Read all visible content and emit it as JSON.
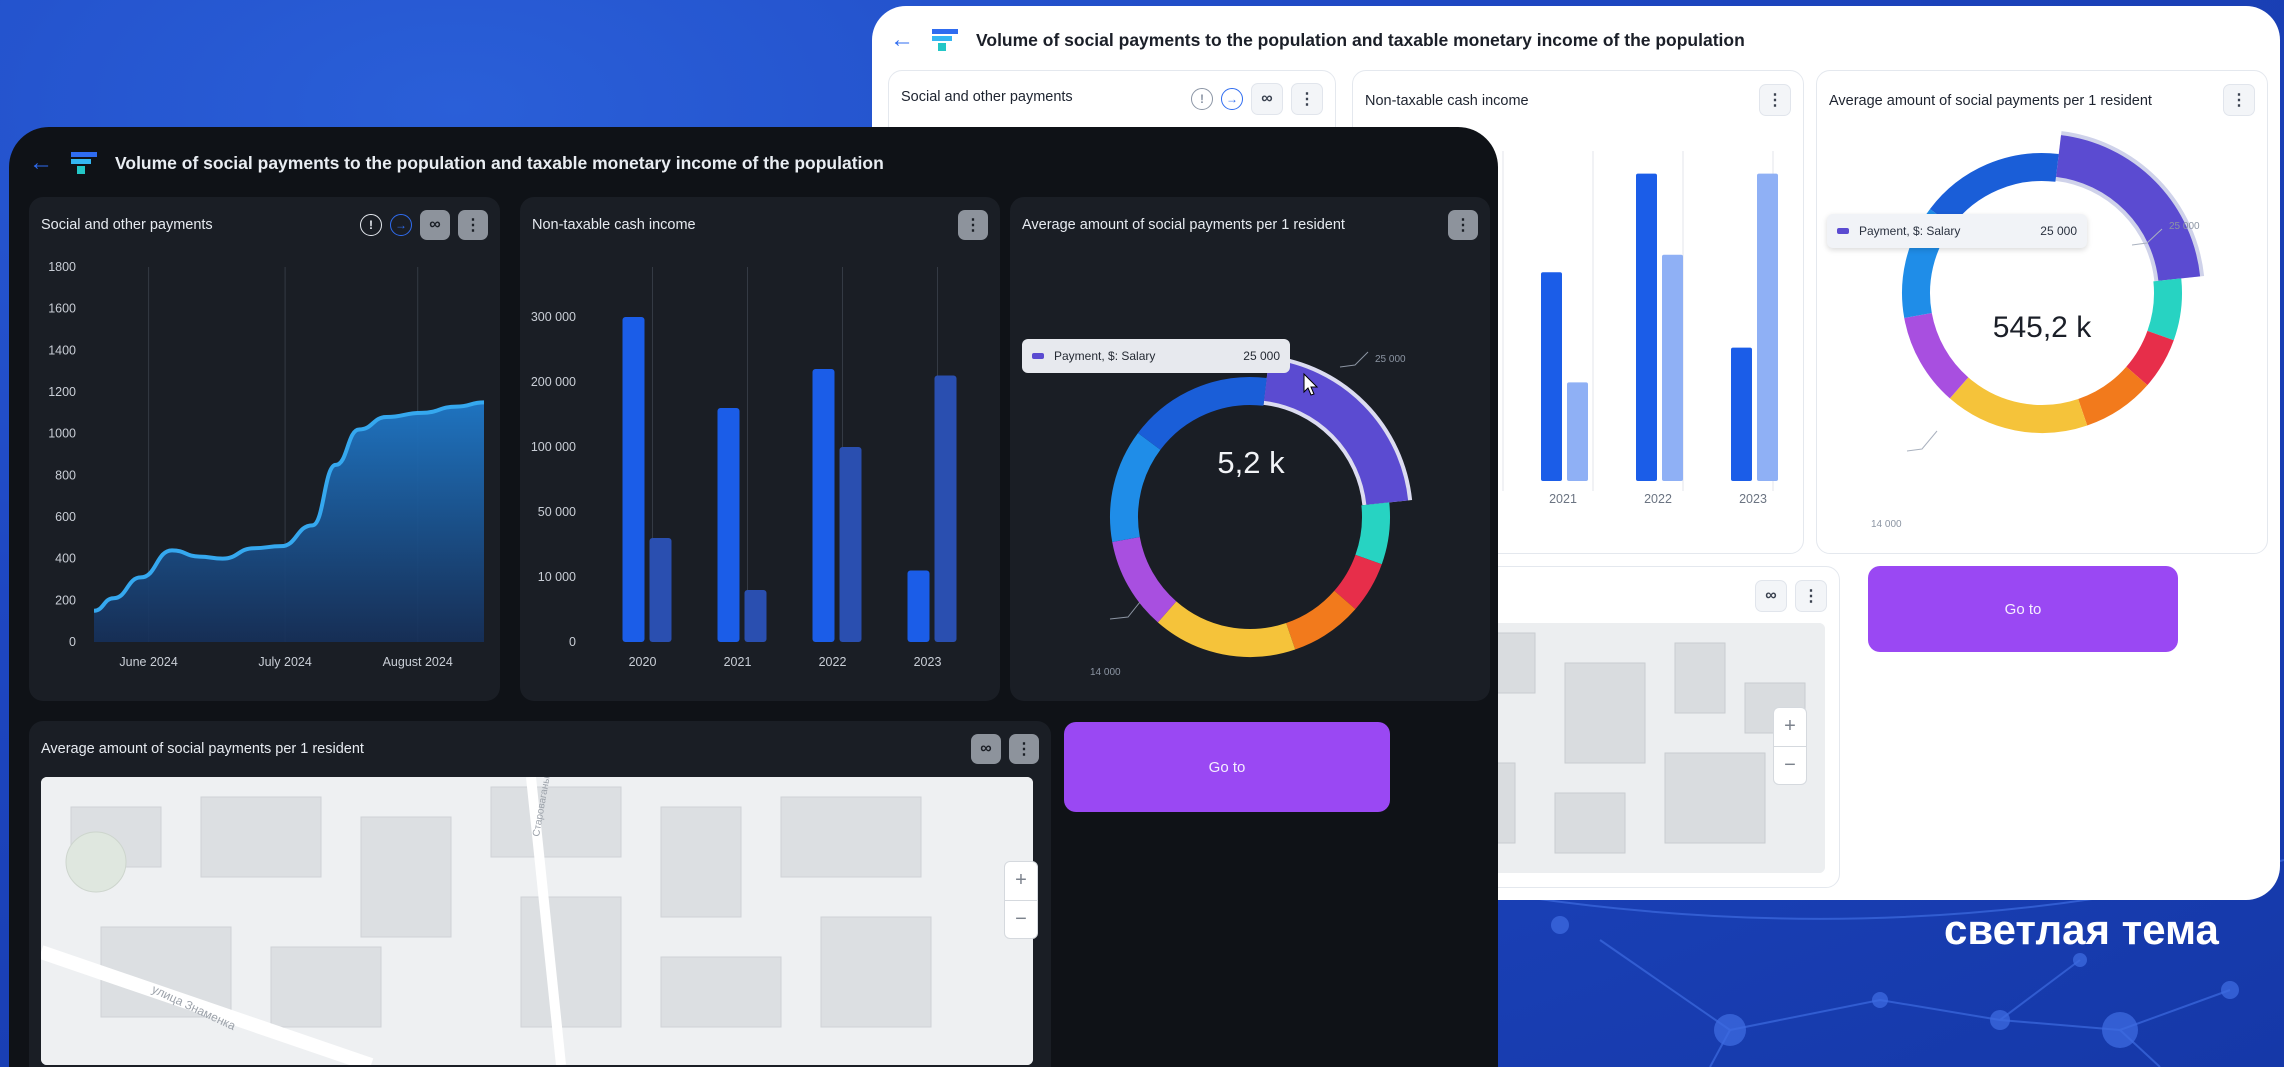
{
  "theme_label": "светлая тема",
  "colors": {
    "accent": "#2f6cf0",
    "goto": "#9a48f3",
    "bar_primary": "#1b5de8",
    "bar_secondary": "#2a4fb0",
    "bar_secondary_light": "#8fb0f5",
    "area_line": "#35a8ef"
  },
  "dark": {
    "title": "Volume of social payments to the population and taxable monetary income of the population",
    "area_card": {
      "title": "Social and other payments",
      "chart_data": {
        "type": "area",
        "title": "Social and other payments",
        "x_ticks": [
          "June 2024",
          "July 2024",
          "August 2024"
        ],
        "y_ticks": [
          "1800",
          "1600",
          "1400",
          "1200",
          "1000",
          "800",
          "600",
          "400",
          "200",
          "0"
        ],
        "ylim": [
          0,
          1800
        ],
        "x": [
          0,
          0.05,
          0.12,
          0.2,
          0.27,
          0.33,
          0.41,
          0.48,
          0.56,
          0.62,
          0.68,
          0.75,
          0.84,
          0.93,
          1.0
        ],
        "values": [
          150,
          210,
          310,
          440,
          410,
          400,
          450,
          460,
          560,
          850,
          1020,
          1080,
          1100,
          1130,
          1150
        ],
        "grid": true
      }
    },
    "bar_card": {
      "title": "Non-taxable cash income",
      "chart_data": {
        "type": "bar",
        "title": "Non-taxable cash income",
        "categories": [
          "2020",
          "2021",
          "2022",
          "2023"
        ],
        "y_ticks": [
          "300 000",
          "200 000",
          "100 000",
          "50 000",
          "10 000",
          "0"
        ],
        "series": [
          {
            "values": [
              5.0,
              3.6,
              4.2,
              1.1
            ]
          },
          {
            "values": [
              1.6,
              0.8,
              3.0,
              4.1
            ]
          }
        ],
        "note": "y axis is non-linear: 0,10 000,50 000,100 000,200 000,300 000 at equal spacing; values in tick index units",
        "grid": true
      }
    },
    "donut_card": {
      "title": "Average amount of social payments per 1 resident",
      "center": "5,2 k",
      "tooltip": {
        "label": "Payment, $: Salary",
        "value": "25 000"
      },
      "callout_top": "25 000",
      "callout_bottom": "14 000",
      "chart_data": {
        "type": "pie",
        "donut": true,
        "segments": [
          {
            "color": "#5b4bd1",
            "value": 25000,
            "label": "Payment, $: Salary"
          },
          {
            "color": "#27d3c2",
            "value": 6
          },
          {
            "color": "#e72e4a",
            "value": 5
          },
          {
            "color": "#f27a1c",
            "value": 7
          },
          {
            "color": "#f5c33a",
            "value": 14
          },
          {
            "color": "#a84fe0",
            "value": 9
          },
          {
            "color": "#1f8de8",
            "value": 11
          },
          {
            "color": "#1a5ed8",
            "value": 14
          }
        ]
      }
    },
    "map_card": {
      "title": "Average amount of social payments per 1 resident",
      "street_1": "улица Знаменка",
      "street_2": "Староваганьковский"
    },
    "goto_label": "Go to"
  },
  "light": {
    "title": "Volume of social payments to the population and taxable monetary income of the population",
    "area_card": {
      "title": "Social and other payments"
    },
    "bar_card": {
      "title": "Non-taxable cash income",
      "chart_data": {
        "type": "bar",
        "categories": [
          "2021",
          "2022",
          "2023"
        ],
        "series": [
          {
            "values": [
              3.6,
              5.3,
              2.3
            ]
          },
          {
            "values": [
              1.7,
              3.9,
              5.3
            ]
          }
        ]
      }
    },
    "donut_card": {
      "title": "Average amount of social payments per 1 resident",
      "center": "545,2 k",
      "tooltip": {
        "label": "Payment, $: Salary",
        "value": "25 000"
      },
      "callout_top": "25 000",
      "callout_bottom": "14 000"
    },
    "goto_label": "Go to"
  }
}
